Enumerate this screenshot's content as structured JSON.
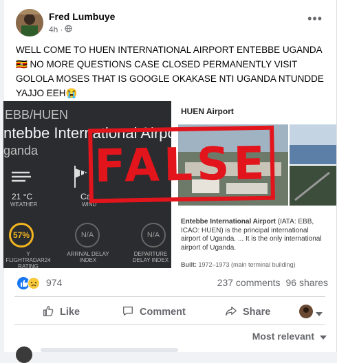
{
  "post": {
    "author": "Fred Lumbuye",
    "time": "4h",
    "text_line1": "WELL COME TO HUEN INTERNATIONAL AIRPORT ENTEBBE UGANDA",
    "text_line2": "🇺🇬 NO MORE QUESTIONS CASE CLOSED PERMANENTLY VISIT",
    "text_line3": "GOLOLA MOSES THAT IS GOOGLE OKAKASE NTI UGANDA NTUNDDE",
    "text_line4": "YAJJO EEH😭"
  },
  "image": {
    "code": "EBB/HUEN",
    "airport_name": "ntebbe International Airport",
    "country": "ganda",
    "temperature": "21 °C",
    "weather_label": "WEATHER",
    "wind_value": "Cal",
    "wind_label": "WIND",
    "rating_value": "57%",
    "rating_label": "Y FLIGHTRADAR24 RATING",
    "arrival_value": "N/A",
    "arrival_label": "ARRIVAL DELAY INDEX",
    "departure_value": "N/A",
    "departure_label": "DEPARTURE DELAY INDEX",
    "stamp": "FALSE",
    "panel_title": "HUEN Airport",
    "wiki_bold": "Entebbe International Airport",
    "wiki_text": " (IATA: EBB, ICAO: HUEN) is the principal international airport of Uganda. ... It is the only international airport of Uganda.",
    "built_label": "Built:",
    "built_value": " 1972–1973 (main terminal building)"
  },
  "stats": {
    "reactions": "974",
    "comments": "237 comments",
    "shares": "96 shares"
  },
  "actions": {
    "like": "Like",
    "comment": "Comment",
    "share": "Share"
  },
  "sort": "Most relevant",
  "colors": {
    "stamp": "#e2141c",
    "like_blue": "#1877f2"
  }
}
